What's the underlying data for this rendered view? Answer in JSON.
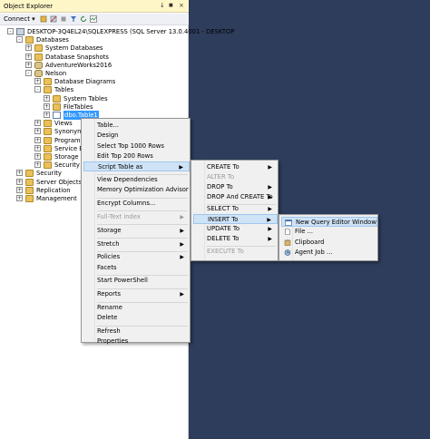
{
  "object_explorer": {
    "title": "Object Explorer",
    "pin_glyph": "↓",
    "pin2_glyph": "■",
    "close_glyph": "×",
    "connect_label": "Connect ▾",
    "tree": [
      {
        "label": "DESKTOP-3Q4EL24\\SQLEXPRESS (SQL Server 13.0.4001 - DESKTOP",
        "level": 0,
        "exp": "-",
        "icon": "server-icon"
      },
      {
        "label": "Databases",
        "level": 1,
        "exp": "-",
        "icon": "folder-icon"
      },
      {
        "label": "System Databases",
        "level": 2,
        "exp": "+",
        "icon": "folder-icon"
      },
      {
        "label": "Database Snapshots",
        "level": 2,
        "exp": "+",
        "icon": "folder-icon"
      },
      {
        "label": "AdventureWorks2016",
        "level": 2,
        "exp": "+",
        "icon": "database-icon"
      },
      {
        "label": "Nelson",
        "level": 2,
        "exp": "-",
        "icon": "database-icon"
      },
      {
        "label": "Database Diagrams",
        "level": 3,
        "exp": "+",
        "icon": "folder-icon"
      },
      {
        "label": "Tables",
        "level": 3,
        "exp": "-",
        "icon": "folder-icon"
      },
      {
        "label": "System Tables",
        "level": 4,
        "exp": "+",
        "icon": "folder-icon"
      },
      {
        "label": "FileTables",
        "level": 4,
        "exp": "+",
        "icon": "folder-icon"
      },
      {
        "label": "dbo.Table1",
        "level": 4,
        "exp": "+",
        "icon": "table-icon",
        "selected": true
      },
      {
        "label": "Views",
        "level": 3,
        "exp": "+",
        "icon": "folder-icon"
      },
      {
        "label": "Synonyms",
        "level": 3,
        "exp": "+",
        "icon": "folder-icon"
      },
      {
        "label": "Programm",
        "level": 3,
        "exp": "+",
        "icon": "folder-icon"
      },
      {
        "label": "Service Bro",
        "level": 3,
        "exp": "+",
        "icon": "folder-icon"
      },
      {
        "label": "Storage",
        "level": 3,
        "exp": "+",
        "icon": "folder-icon"
      },
      {
        "label": "Security",
        "level": 3,
        "exp": "+",
        "icon": "folder-icon"
      },
      {
        "label": "Security",
        "level": 1,
        "exp": "+",
        "icon": "folder-icon"
      },
      {
        "label": "Server Objects",
        "level": 1,
        "exp": "+",
        "icon": "folder-icon"
      },
      {
        "label": "Replication",
        "level": 1,
        "exp": "+",
        "icon": "folder-icon"
      },
      {
        "label": "Management",
        "level": 1,
        "exp": "+",
        "icon": "folder-icon"
      }
    ]
  },
  "context_menu": {
    "items": [
      {
        "label": "Table..."
      },
      {
        "label": "Design"
      },
      {
        "label": "Select Top 1000 Rows"
      },
      {
        "label": "Edit Top 200 Rows"
      },
      {
        "label": "Script Table as",
        "submenu": true,
        "highlight": true
      },
      {
        "sep": true
      },
      {
        "label": "View Dependencies"
      },
      {
        "label": "Memory Optimization Advisor"
      },
      {
        "sep": true
      },
      {
        "label": "Encrypt Columns..."
      },
      {
        "sep": true
      },
      {
        "label": "Full-Text index",
        "submenu": true,
        "disabled": true
      },
      {
        "sep": true
      },
      {
        "label": "Storage",
        "submenu": true
      },
      {
        "sep": true
      },
      {
        "label": "Stretch",
        "submenu": true
      },
      {
        "sep": true
      },
      {
        "label": "Policies",
        "submenu": true
      },
      {
        "label": "Facets"
      },
      {
        "sep": true
      },
      {
        "label": "Start PowerShell"
      },
      {
        "sep": true
      },
      {
        "label": "Reports",
        "submenu": true
      },
      {
        "sep": true
      },
      {
        "label": "Rename"
      },
      {
        "label": "Delete"
      },
      {
        "sep": true
      },
      {
        "label": "Refresh"
      },
      {
        "label": "Properties"
      }
    ]
  },
  "script_submenu": {
    "items": [
      {
        "label": "CREATE To",
        "submenu": true
      },
      {
        "label": "ALTER To",
        "disabled": true
      },
      {
        "label": "DROP To",
        "submenu": true
      },
      {
        "label": "DROP And CREATE To",
        "submenu": true
      },
      {
        "sep": true
      },
      {
        "label": "SELECT To",
        "submenu": true
      },
      {
        "label": "INSERT To",
        "submenu": true,
        "highlight": true
      },
      {
        "label": "UPDATE To",
        "submenu": true
      },
      {
        "label": "DELETE To",
        "submenu": true
      },
      {
        "sep": true
      },
      {
        "label": "EXECUTE To",
        "disabled": true
      }
    ]
  },
  "insert_submenu": {
    "items": [
      {
        "label": "New Query Editor Window",
        "highlight": true,
        "icon": "query-window-icon"
      },
      {
        "label": "File ...",
        "icon": "file-icon"
      },
      {
        "label": "Clipboard",
        "icon": "clipboard-icon"
      },
      {
        "label": "Agent Job ...",
        "icon": "agent-job-icon"
      }
    ]
  },
  "arrow_glyph": "▶"
}
